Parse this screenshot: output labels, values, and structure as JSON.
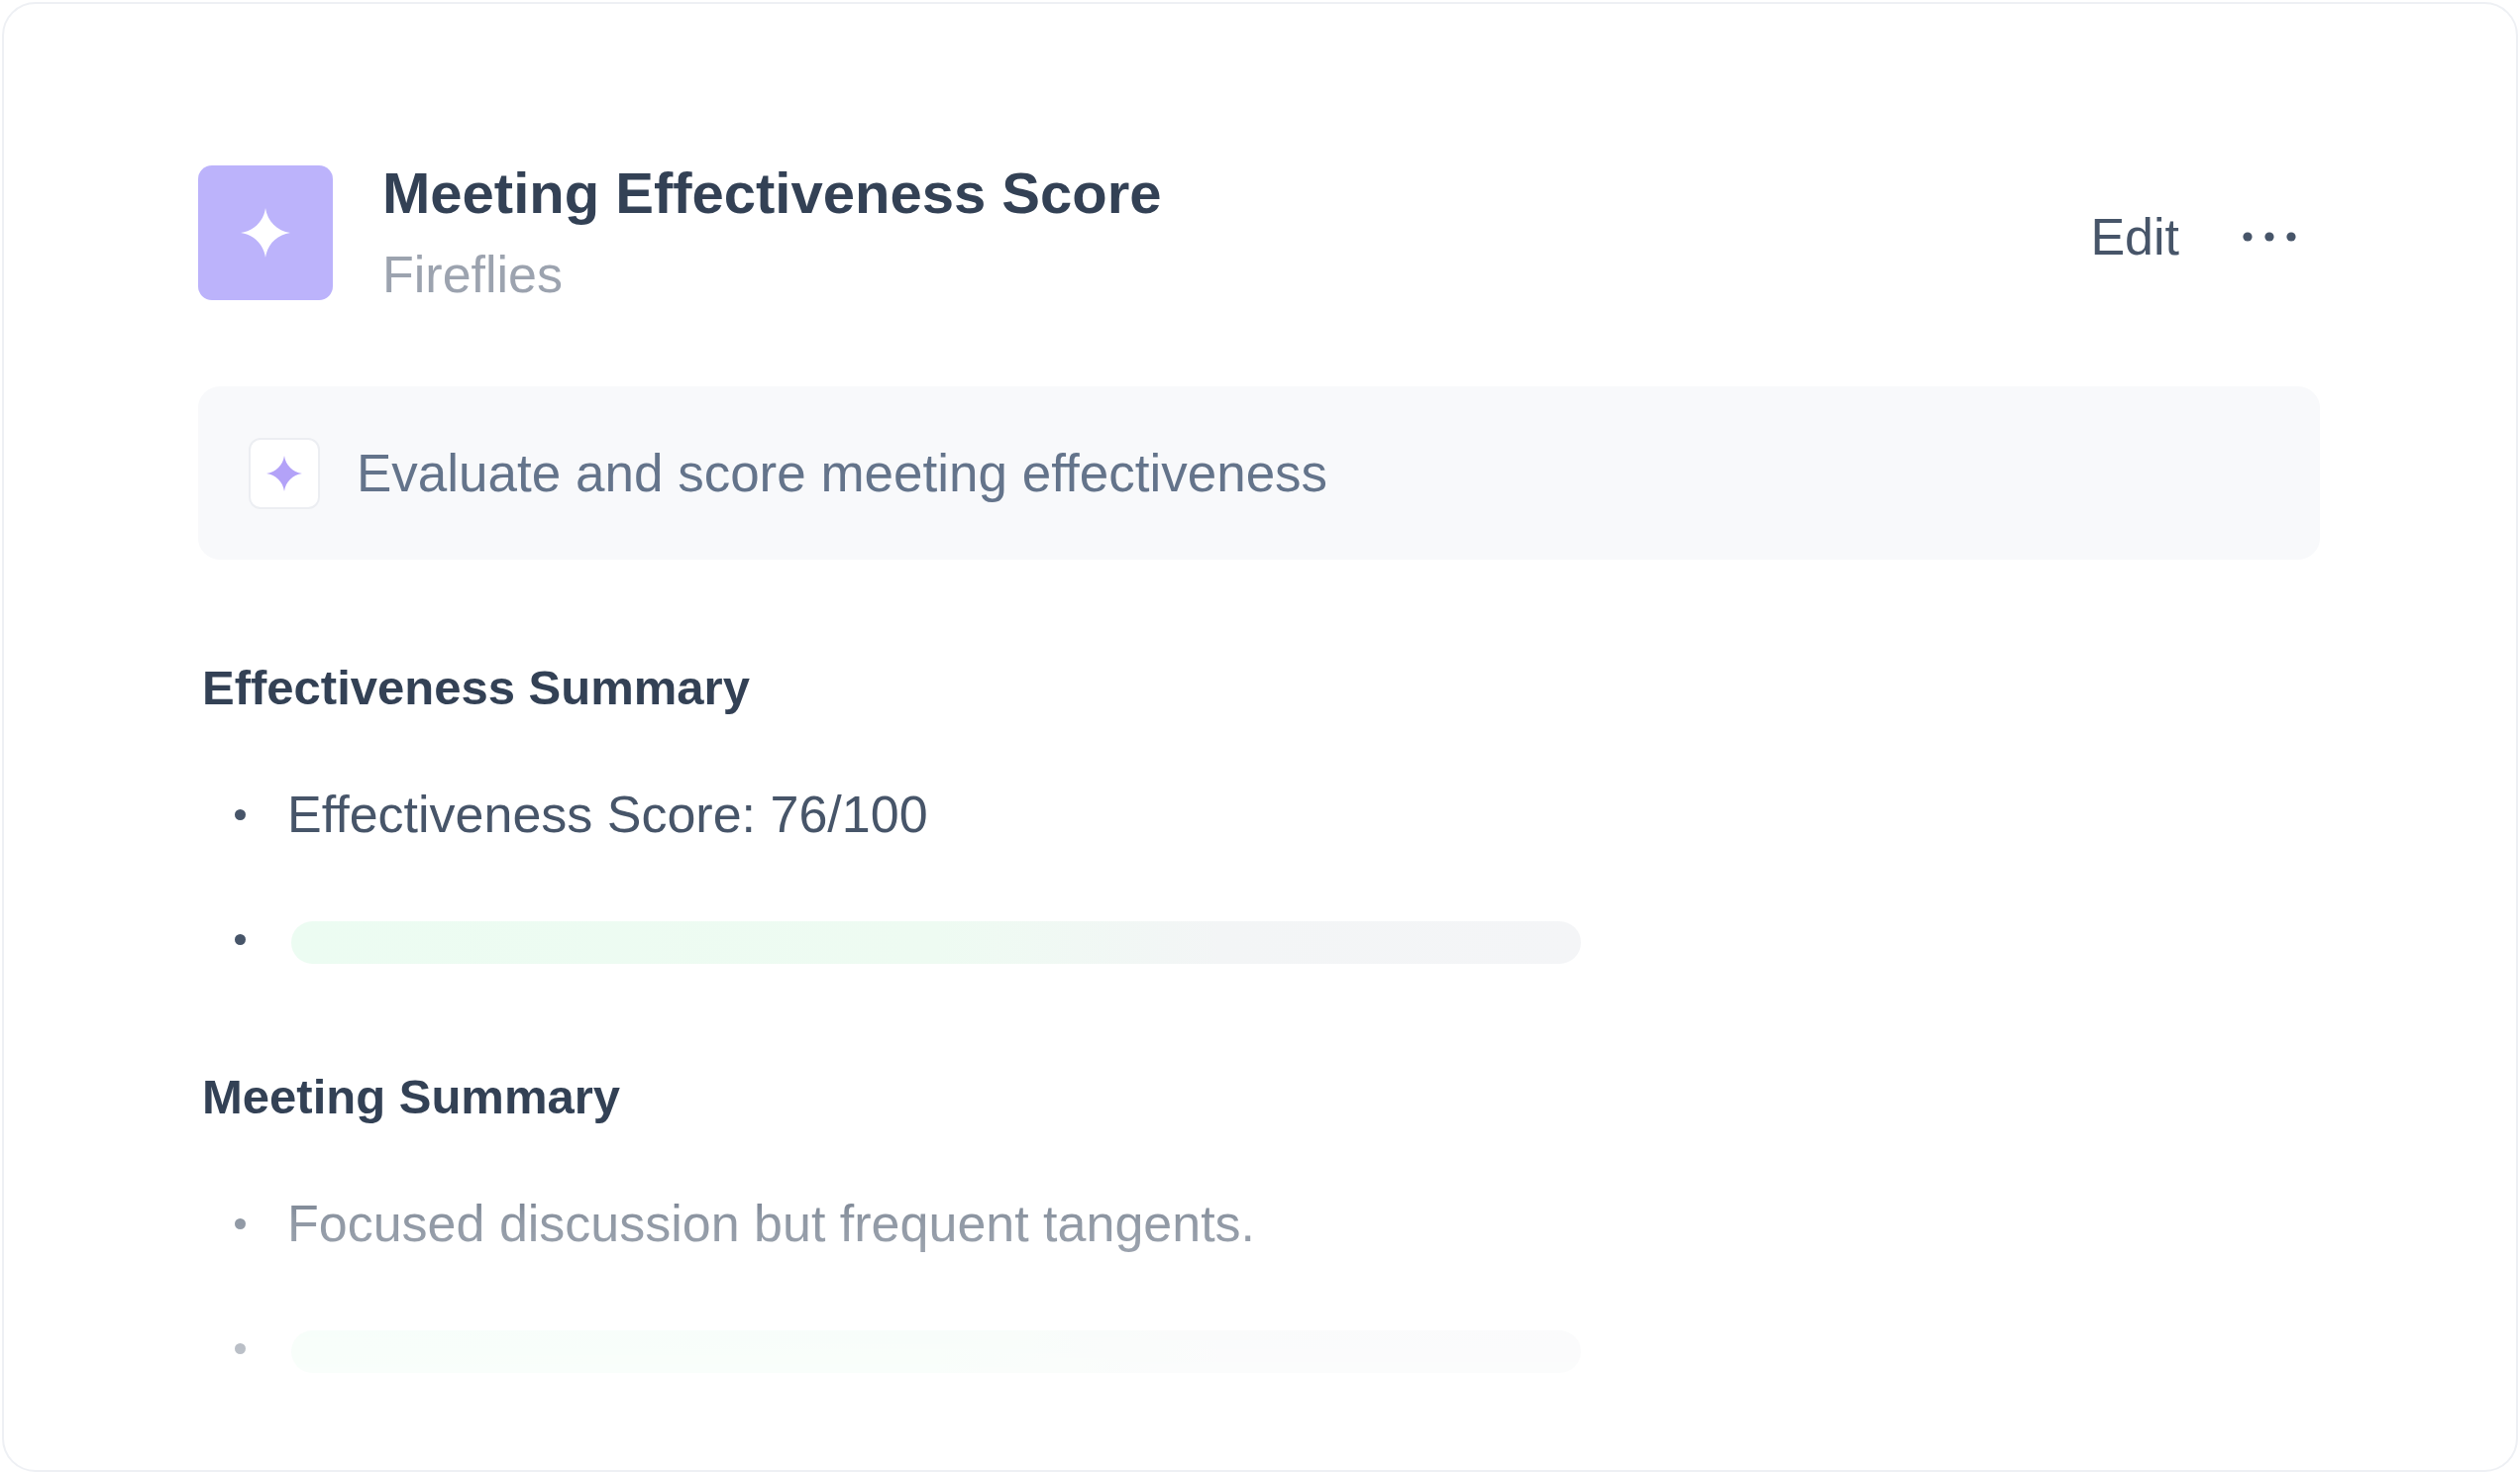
{
  "card": {
    "title": "Meeting Effectiveness Score",
    "source": "Fireflies",
    "edit_label": "Edit",
    "prompt": "Evaluate and score meeting effectiveness",
    "sections": [
      {
        "heading": "Effectiveness Summary",
        "items": [
          {
            "kind": "text",
            "text": "Effectiveness Score: 76/100"
          },
          {
            "kind": "skeleton"
          }
        ]
      },
      {
        "heading": "Meeting Summary",
        "items": [
          {
            "kind": "text",
            "text": "Focused discussion but frequent tangents."
          },
          {
            "kind": "skeleton"
          }
        ]
      }
    ]
  }
}
